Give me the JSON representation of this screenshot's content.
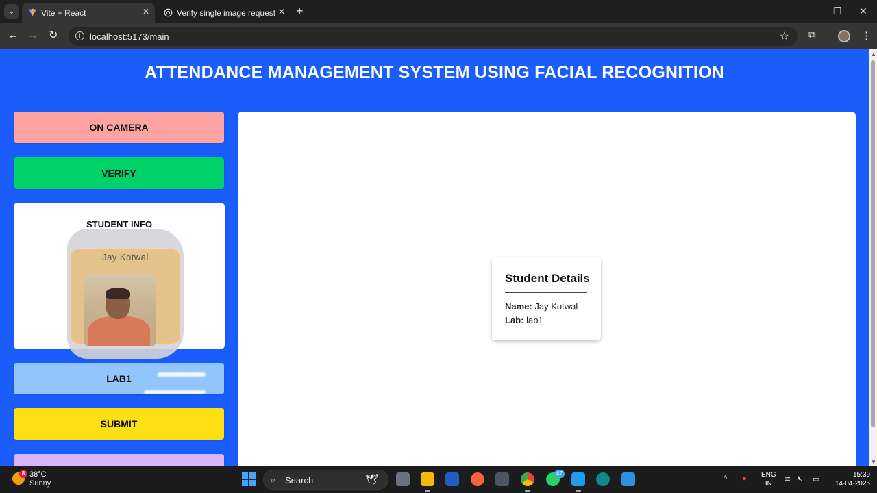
{
  "browser": {
    "tabs": [
      {
        "title": "Vite + React",
        "active": true
      },
      {
        "title": "Verify single image request",
        "active": false
      }
    ],
    "url": "localhost:5173/main"
  },
  "app": {
    "title": "ATTENDANCE MANAGEMENT SYSTEM USING FACIAL RECOGNITION",
    "buttons": {
      "camera": "ON CAMERA",
      "verify": "VERIFY",
      "lab": "LAB1",
      "submit": "SUBMIT"
    },
    "student_info": {
      "heading": "STUDENT INFO",
      "name_overlay": "Jay Kotwal"
    },
    "details": {
      "heading": "Student Details",
      "name_label": "Name:",
      "name_value": "Jay Kotwal",
      "lab_label": "Lab:",
      "lab_value": "lab1"
    },
    "colors": {
      "background": "#1a5dfb",
      "camera_button": "#fea3a3",
      "verify_button": "#00d26a",
      "lab_button": "#93c5fd",
      "submit_button": "#fde014",
      "extra_button": "#d8b4fe"
    }
  },
  "taskbar": {
    "weather": {
      "temp": "38°C",
      "condition": "Sunny",
      "badge": "8"
    },
    "search_label": "Search",
    "whatsapp_badge": "47",
    "lang_line1": "ENG",
    "lang_line2": "IN",
    "time": "15:39",
    "date": "14-04-2025"
  }
}
